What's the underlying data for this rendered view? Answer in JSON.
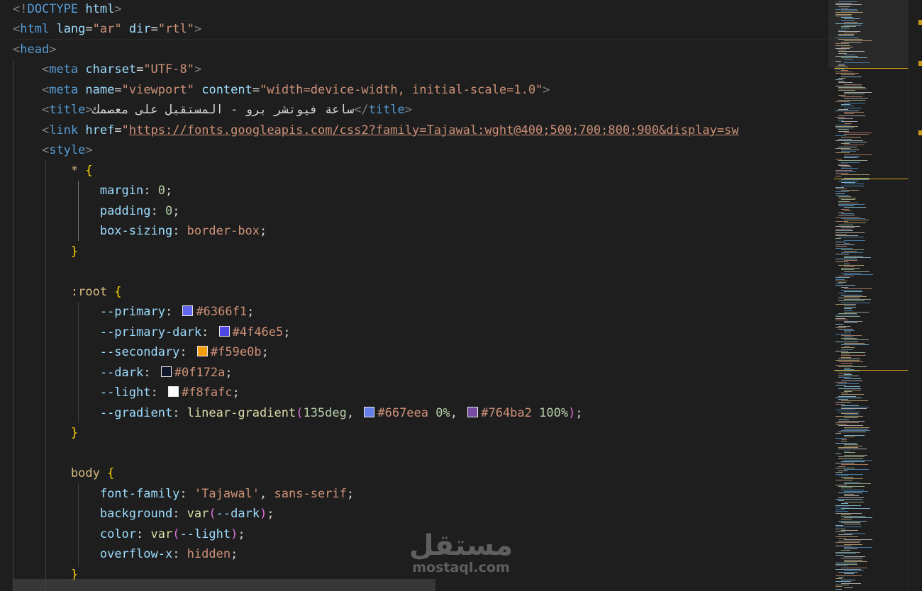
{
  "editor": {
    "title_text": "ساعة فيوتشر برو - المستقبل على معصمك",
    "url": "https://fonts.googleapis.com/css2?family=Tajawal:wght@400;500;700;800;900&display=sw",
    "colors": {
      "primary": "#6366f1",
      "primary_dark": "#4f46e5",
      "secondary": "#f59e0b",
      "dark": "#0f172a",
      "light": "#f8fafc",
      "grad_a": "#667eea",
      "grad_b": "#764ba2",
      "scroll_marker": "#c99a19"
    },
    "lines": [
      [
        [
          "punct",
          "<!"
        ],
        [
          "tag",
          "DOCTYPE"
        ],
        [
          "text",
          " "
        ],
        [
          "attr",
          "html"
        ],
        [
          "punct",
          ">"
        ]
      ],
      [
        [
          "punct",
          "<"
        ],
        [
          "tag",
          "html"
        ],
        [
          "text",
          " "
        ],
        [
          "attr",
          "lang"
        ],
        [
          "text",
          "="
        ],
        [
          "str",
          "\"ar\""
        ],
        [
          "text",
          " "
        ],
        [
          "attr",
          "dir"
        ],
        [
          "text",
          "="
        ],
        [
          "str",
          "\"rtl\""
        ],
        [
          "punct",
          ">"
        ]
      ],
      [
        [
          "punct",
          "<"
        ],
        [
          "tag",
          "head"
        ],
        [
          "punct",
          ">"
        ]
      ],
      [
        [
          "ind",
          "    "
        ],
        [
          "punct",
          "<"
        ],
        [
          "tag",
          "meta"
        ],
        [
          "text",
          " "
        ],
        [
          "attr",
          "charset"
        ],
        [
          "text",
          "="
        ],
        [
          "str",
          "\"UTF-8\""
        ],
        [
          "punct",
          ">"
        ]
      ],
      [
        [
          "ind",
          "    "
        ],
        [
          "punct",
          "<"
        ],
        [
          "tag",
          "meta"
        ],
        [
          "text",
          " "
        ],
        [
          "attr",
          "name"
        ],
        [
          "text",
          "="
        ],
        [
          "str",
          "\"viewport\""
        ],
        [
          "text",
          " "
        ],
        [
          "attr",
          "content"
        ],
        [
          "text",
          "="
        ],
        [
          "str",
          "\"width=device-width, initial-scale=1.0\""
        ],
        [
          "punct",
          ">"
        ]
      ],
      [
        [
          "ind",
          "    "
        ],
        [
          "punct",
          "<"
        ],
        [
          "tag",
          "title"
        ],
        [
          "punct",
          ">"
        ],
        [
          "rtl",
          "ساعة فيوتشر برو - المستقبل على معصمك"
        ],
        [
          "punct",
          "</"
        ],
        [
          "tag",
          "title"
        ],
        [
          "punct",
          ">"
        ]
      ],
      [
        [
          "ind",
          "    "
        ],
        [
          "punct",
          "<"
        ],
        [
          "tag",
          "link"
        ],
        [
          "text",
          " "
        ],
        [
          "attr",
          "href"
        ],
        [
          "text",
          "="
        ],
        [
          "str",
          "\""
        ],
        [
          "url",
          "https://fonts.googleapis.com/css2?family=Tajawal:wght@400;500;700;800;900&display=sw"
        ]
      ],
      [
        [
          "ind",
          "    "
        ],
        [
          "punct",
          "<"
        ],
        [
          "tag",
          "style"
        ],
        [
          "punct",
          ">"
        ]
      ],
      [
        [
          "ind",
          "        "
        ],
        [
          "sel",
          "* "
        ],
        [
          "brace",
          "{"
        ]
      ],
      [
        [
          "ind",
          "            "
        ],
        [
          "prop",
          "margin"
        ],
        [
          "text",
          ": "
        ],
        [
          "num",
          "0"
        ],
        [
          "text",
          ";"
        ]
      ],
      [
        [
          "ind",
          "            "
        ],
        [
          "prop",
          "padding"
        ],
        [
          "text",
          ": "
        ],
        [
          "num",
          "0"
        ],
        [
          "text",
          ";"
        ]
      ],
      [
        [
          "ind",
          "            "
        ],
        [
          "prop",
          "box-sizing"
        ],
        [
          "text",
          ": "
        ],
        [
          "val",
          "border-box"
        ],
        [
          "text",
          ";"
        ]
      ],
      [
        [
          "ind",
          "        "
        ],
        [
          "brace",
          "}"
        ]
      ],
      [],
      [
        [
          "ind",
          "        "
        ],
        [
          "sel",
          ":root "
        ],
        [
          "brace",
          "{"
        ]
      ],
      [
        [
          "ind",
          "            "
        ],
        [
          "prop",
          "--primary"
        ],
        [
          "text",
          ": "
        ],
        [
          "swatch",
          "#6366f1"
        ],
        [
          "val",
          "#6366f1"
        ],
        [
          "text",
          ";"
        ]
      ],
      [
        [
          "ind",
          "            "
        ],
        [
          "prop",
          "--primary-dark"
        ],
        [
          "text",
          ": "
        ],
        [
          "swatch",
          "#4f46e5"
        ],
        [
          "val",
          "#4f46e5"
        ],
        [
          "text",
          ";"
        ]
      ],
      [
        [
          "ind",
          "            "
        ],
        [
          "prop",
          "--secondary"
        ],
        [
          "text",
          ": "
        ],
        [
          "swatch",
          "#f59e0b"
        ],
        [
          "val",
          "#f59e0b"
        ],
        [
          "text",
          ";"
        ]
      ],
      [
        [
          "ind",
          "            "
        ],
        [
          "prop",
          "--dark"
        ],
        [
          "text",
          ": "
        ],
        [
          "swatch",
          "#0f172a"
        ],
        [
          "val",
          "#0f172a"
        ],
        [
          "text",
          ";"
        ]
      ],
      [
        [
          "ind",
          "            "
        ],
        [
          "prop",
          "--light"
        ],
        [
          "text",
          ": "
        ],
        [
          "swatch",
          "#f8fafc"
        ],
        [
          "val",
          "#f8fafc"
        ],
        [
          "text",
          ";"
        ]
      ],
      [
        [
          "ind",
          "            "
        ],
        [
          "prop",
          "--gradient"
        ],
        [
          "text",
          ": "
        ],
        [
          "fn",
          "linear-gradient"
        ],
        [
          "paren",
          "("
        ],
        [
          "num",
          "135deg"
        ],
        [
          "text",
          ", "
        ],
        [
          "swatch",
          "#667eea"
        ],
        [
          "val",
          "#667eea"
        ],
        [
          "text",
          " "
        ],
        [
          "num",
          "0%"
        ],
        [
          "text",
          ", "
        ],
        [
          "swatch",
          "#764ba2"
        ],
        [
          "val",
          "#764ba2"
        ],
        [
          "text",
          " "
        ],
        [
          "num",
          "100%"
        ],
        [
          "paren",
          ")"
        ],
        [
          "text",
          ";"
        ]
      ],
      [
        [
          "ind",
          "        "
        ],
        [
          "brace",
          "}"
        ]
      ],
      [],
      [
        [
          "ind",
          "        "
        ],
        [
          "sel",
          "body "
        ],
        [
          "brace",
          "{"
        ]
      ],
      [
        [
          "ind",
          "            "
        ],
        [
          "prop",
          "font-family"
        ],
        [
          "text",
          ": "
        ],
        [
          "val",
          "'Tajawal'"
        ],
        [
          "text",
          ", "
        ],
        [
          "val",
          "sans-serif"
        ],
        [
          "text",
          ";"
        ]
      ],
      [
        [
          "ind",
          "            "
        ],
        [
          "prop",
          "background"
        ],
        [
          "text",
          ": "
        ],
        [
          "fn",
          "var"
        ],
        [
          "paren",
          "("
        ],
        [
          "prop",
          "--dark"
        ],
        [
          "paren",
          ")"
        ],
        [
          "text",
          ";"
        ]
      ],
      [
        [
          "ind",
          "            "
        ],
        [
          "prop",
          "color"
        ],
        [
          "text",
          ": "
        ],
        [
          "fn",
          "var"
        ],
        [
          "paren",
          "("
        ],
        [
          "prop",
          "--light"
        ],
        [
          "paren",
          ")"
        ],
        [
          "text",
          ";"
        ]
      ],
      [
        [
          "ind",
          "            "
        ],
        [
          "prop",
          "overflow-x"
        ],
        [
          "text",
          ": "
        ],
        [
          "val",
          "hidden"
        ],
        [
          "text",
          ";"
        ]
      ],
      [
        [
          "ind",
          "        "
        ],
        [
          "brace",
          "}"
        ]
      ]
    ]
  },
  "watermark": {
    "logo_text": "مستقل",
    "url_text": "mostaql.com"
  }
}
